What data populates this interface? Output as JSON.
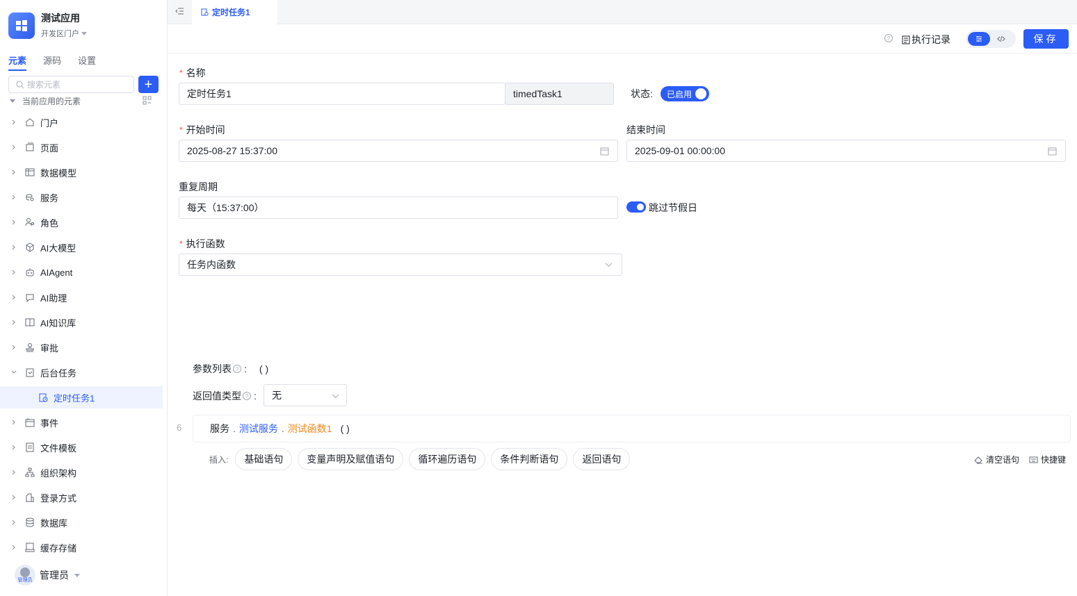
{
  "app": {
    "name": "测试应用",
    "portal": "开发区门户"
  },
  "sidebar": {
    "tabs": [
      "元素",
      "源码",
      "设置"
    ],
    "search_placeholder": "搜索元素",
    "root_label": "当前应用的元素",
    "items": [
      {
        "label": "门户",
        "icon": "home-icon"
      },
      {
        "label": "页面",
        "icon": "pages-icon"
      },
      {
        "label": "数据模型",
        "icon": "table-icon"
      },
      {
        "label": "服务",
        "icon": "service-icon"
      },
      {
        "label": "角色",
        "icon": "role-icon"
      },
      {
        "label": "AI大模型",
        "icon": "ai-model-icon"
      },
      {
        "label": "AIAgent",
        "icon": "robot-icon"
      },
      {
        "label": "AI助理",
        "icon": "ai-assistant-icon"
      },
      {
        "label": "AI知识库",
        "icon": "knowledge-icon"
      },
      {
        "label": "审批",
        "icon": "stamp-icon"
      },
      {
        "label": "后台任务",
        "icon": "task-icon"
      },
      {
        "label": "事件",
        "icon": "event-icon"
      },
      {
        "label": "文件模板",
        "icon": "file-template-icon"
      },
      {
        "label": "组织架构",
        "icon": "org-icon"
      },
      {
        "label": "登录方式",
        "icon": "login-icon"
      },
      {
        "label": "数据库",
        "icon": "database-icon"
      },
      {
        "label": "缓存存储",
        "icon": "cache-icon"
      }
    ],
    "child_item": "定时任务1",
    "user": {
      "name": "管理员",
      "avatar_label": "管理员"
    }
  },
  "tab": {
    "title": "定时任务1"
  },
  "toolbar": {
    "exec_log": "执行记录",
    "save": "保存"
  },
  "form": {
    "name_label": "名称",
    "name_value": "定时任务1",
    "code_value": "timedTask1",
    "status_label": "状态:",
    "status_value": "已启用",
    "start_label": "开始时间",
    "start_value": "2025-08-27 15:37:00",
    "end_label": "结束时间",
    "end_value": "2025-09-01 00:00:00",
    "repeat_label": "重复周期",
    "repeat_value": "每天（15:37:00）",
    "skip_holiday": "跳过节假日",
    "func_label": "执行函数",
    "func_value": "任务内函数"
  },
  "logic": {
    "params_label": "参数列表",
    "params_value": "(    )",
    "return_label": "返回值类型",
    "return_value": "无",
    "line_num": "6",
    "stmt": {
      "p1": "服务",
      "p2": "测试服务",
      "p3": "测试函数1",
      "p4": "( )"
    },
    "insert_label": "插入:",
    "chips": [
      "基础语句",
      "变量声明及赋值语句",
      "循环遍历语句",
      "条件判断语句",
      "返回语句"
    ],
    "clear": "清空语句",
    "shortcut": "快捷键"
  }
}
